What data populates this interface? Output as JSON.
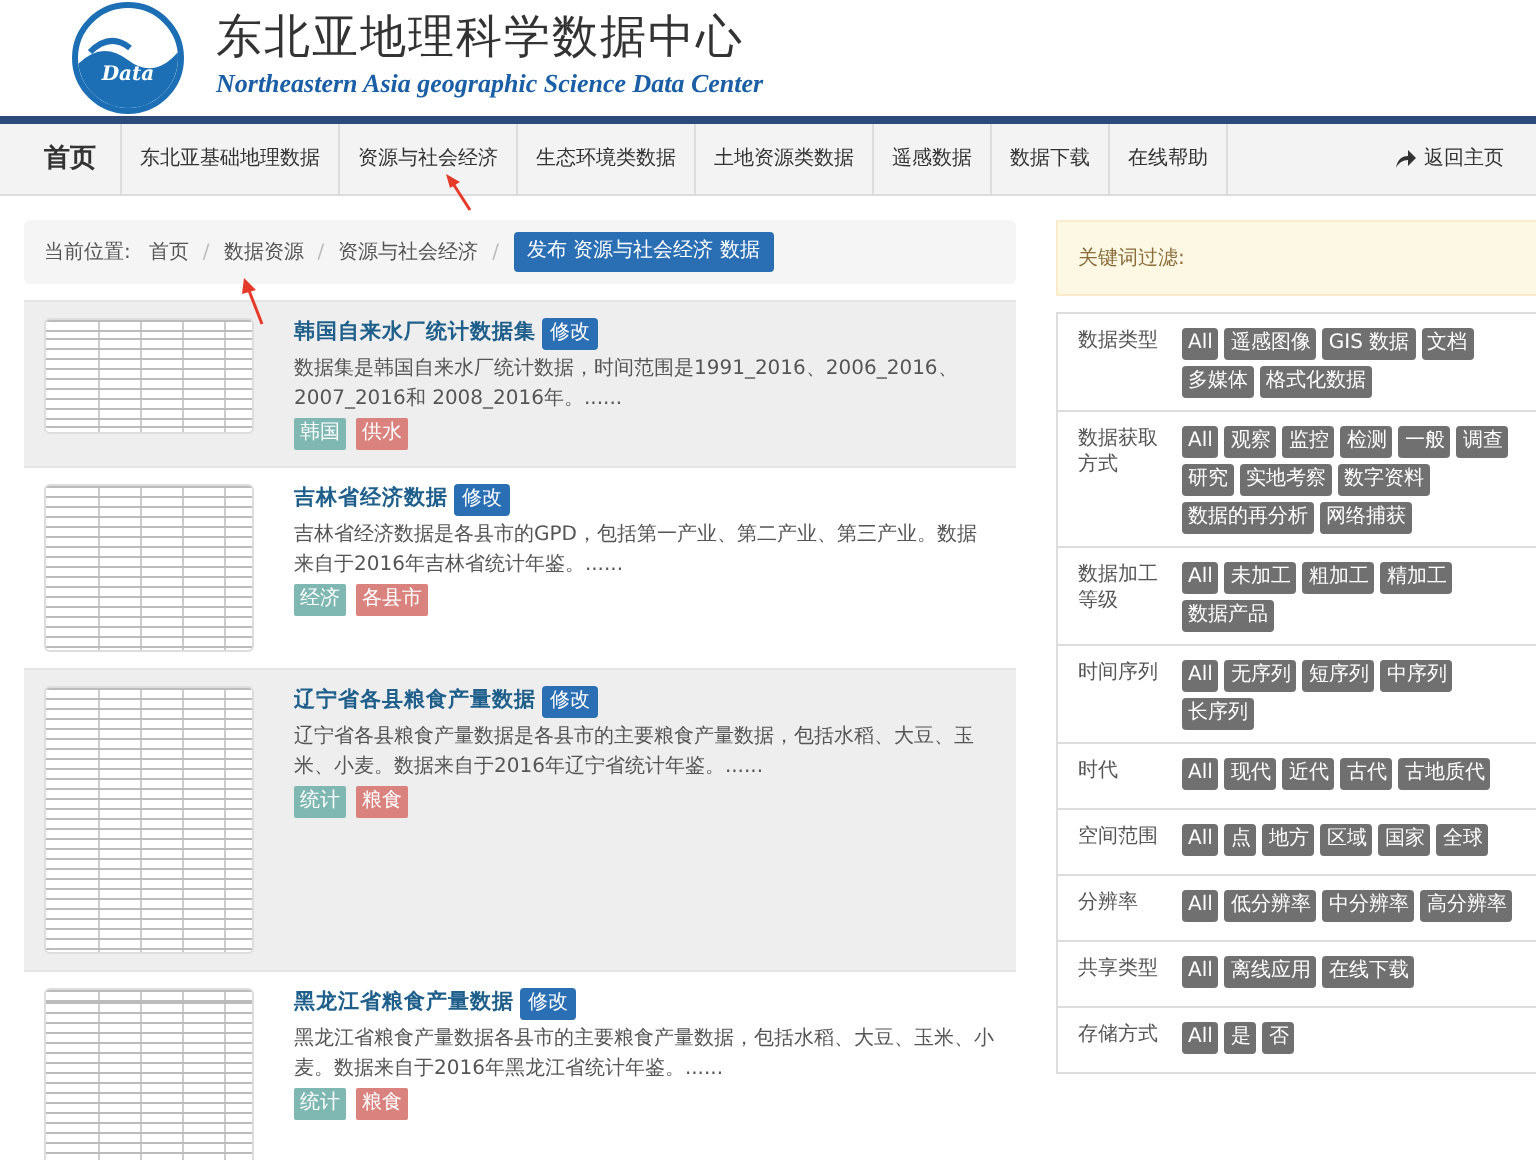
{
  "site": {
    "logo_text": "Data",
    "title": "东北亚地理科学数据中心",
    "subtitle": "Northeastern Asia geographic Science Data Center"
  },
  "nav": {
    "brand": "首页",
    "items": [
      {
        "label": "东北亚基础地理数据",
        "selected": false
      },
      {
        "label": "资源与社会经济",
        "selected": false
      },
      {
        "label": "生态环境类数据",
        "selected": false
      },
      {
        "label": "土地资源类数据",
        "selected": false
      },
      {
        "label": "遥感数据",
        "selected": false
      },
      {
        "label": "数据下载",
        "selected": false
      },
      {
        "label": "在线帮助",
        "selected": false
      }
    ],
    "home_link": "返回主页"
  },
  "breadcrumb": {
    "prefix": "当前位置:",
    "items": [
      "首页",
      "数据资源",
      "资源与社会经济"
    ],
    "separator": "/",
    "button": "发布 资源与社会经济 数据"
  },
  "datasets": [
    {
      "title": "韩国自来水厂统计数据集",
      "edit": "修改",
      "description": "数据集是韩国自来水厂统计数据，时间范围是1991_2016、2006_2016、2007_2016和 2008_2016年。......",
      "tags": [
        {
          "label": "韩国",
          "color": "#7fb8b3"
        },
        {
          "label": "供水",
          "color": "#d9827e"
        }
      ]
    },
    {
      "title": "吉林省经济数据",
      "edit": "修改",
      "description": "吉林省经济数据是各县市的GPD，包括第一产业、第二产业、第三产业。数据来自于2016年吉林省统计年鉴。......",
      "tags": [
        {
          "label": "经济",
          "color": "#7fb8b3"
        },
        {
          "label": "各县市",
          "color": "#d9827e"
        }
      ]
    },
    {
      "title": "辽宁省各县粮食产量数据",
      "edit": "修改",
      "description": "辽宁省各县粮食产量数据是各县市的主要粮食产量数据，包括水稻、大豆、玉米、小麦。数据来自于2016年辽宁省统计年鉴。......",
      "tags": [
        {
          "label": "统计",
          "color": "#7fb8b3"
        },
        {
          "label": "粮食",
          "color": "#d9827e"
        }
      ]
    },
    {
      "title": "黑龙江省粮食产量数据",
      "edit": "修改",
      "description": "黑龙江省粮食产量数据各县市的主要粮食产量数据，包括水稻、大豆、玉米、小麦。数据来自于2016年黑龙江省统计年鉴。......",
      "tags": [
        {
          "label": "统计",
          "color": "#7fb8b3"
        },
        {
          "label": "粮食",
          "color": "#d9827e"
        }
      ]
    }
  ],
  "filter": {
    "header": "关键词过滤:",
    "groups": [
      {
        "label": "数据类型",
        "options": [
          "All",
          "遥感图像",
          "GIS 数据",
          "文档",
          "多媒体",
          "格式化数据"
        ]
      },
      {
        "label": "数据获取方式",
        "options": [
          "All",
          "观察",
          "监控",
          "检测",
          "一般",
          "调查",
          "研究",
          "实地考察",
          "数字资料",
          "数据的再分析",
          "网络捕获"
        ]
      },
      {
        "label": "数据加工等级",
        "options": [
          "All",
          "未加工",
          "粗加工",
          "精加工",
          "数据产品"
        ]
      },
      {
        "label": "时间序列",
        "options": [
          "All",
          "无序列",
          "短序列",
          "中序列",
          "长序列"
        ]
      },
      {
        "label": "时代",
        "options": [
          "All",
          "现代",
          "近代",
          "古代",
          "古地质代"
        ]
      },
      {
        "label": "空间范围",
        "options": [
          "All",
          "点",
          "地方",
          "区域",
          "国家",
          "全球"
        ]
      },
      {
        "label": "分辨率",
        "options": [
          "All",
          "低分辨率",
          "中分辨率",
          "高分辨率"
        ]
      },
      {
        "label": "共享类型",
        "options": [
          "All",
          "离线应用",
          "在线下载"
        ]
      },
      {
        "label": "存储方式",
        "options": [
          "All",
          "是",
          "否"
        ]
      }
    ]
  }
}
